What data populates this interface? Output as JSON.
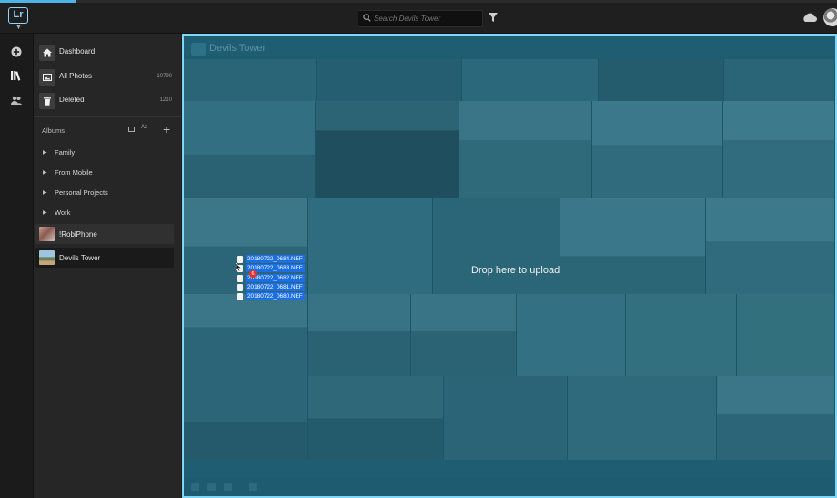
{
  "app": {
    "logo_text": "Lr"
  },
  "progress": {
    "fraction": 0.09
  },
  "search": {
    "placeholder": "Search Devils Tower",
    "value": ""
  },
  "nav": {
    "items": [
      {
        "label": "Dashboard",
        "count": "",
        "icon": "home-icon"
      },
      {
        "label": "All Photos",
        "count": "10790",
        "icon": "photos-icon"
      },
      {
        "label": "Deleted",
        "count": "1210",
        "icon": "trash-icon"
      }
    ]
  },
  "albums": {
    "title": "Albums",
    "sort_label": "Az",
    "add_label": "+",
    "folders": [
      "Family",
      "From Mobile",
      "Personal Projects",
      "Work"
    ],
    "entries": [
      {
        "label": "!RobiPhone",
        "selected": false
      },
      {
        "label": "Devils Tower",
        "selected": true
      }
    ]
  },
  "main": {
    "title": "Devils Tower",
    "drop_text": "Drop here to upload"
  },
  "drag": {
    "count": "6",
    "files": [
      "20180722_0684.NEF",
      "20180722_0683.NEF",
      "20180722_0682.NEF",
      "20180722_0681.NEF",
      "20180722_0680.NEF"
    ]
  },
  "colors": {
    "accent": "#4fb3e8",
    "drop_overlay": "#1f5d72",
    "drop_border": "#7fd6f5",
    "selection": "#1c6fe3",
    "badge": "#e5332a"
  }
}
